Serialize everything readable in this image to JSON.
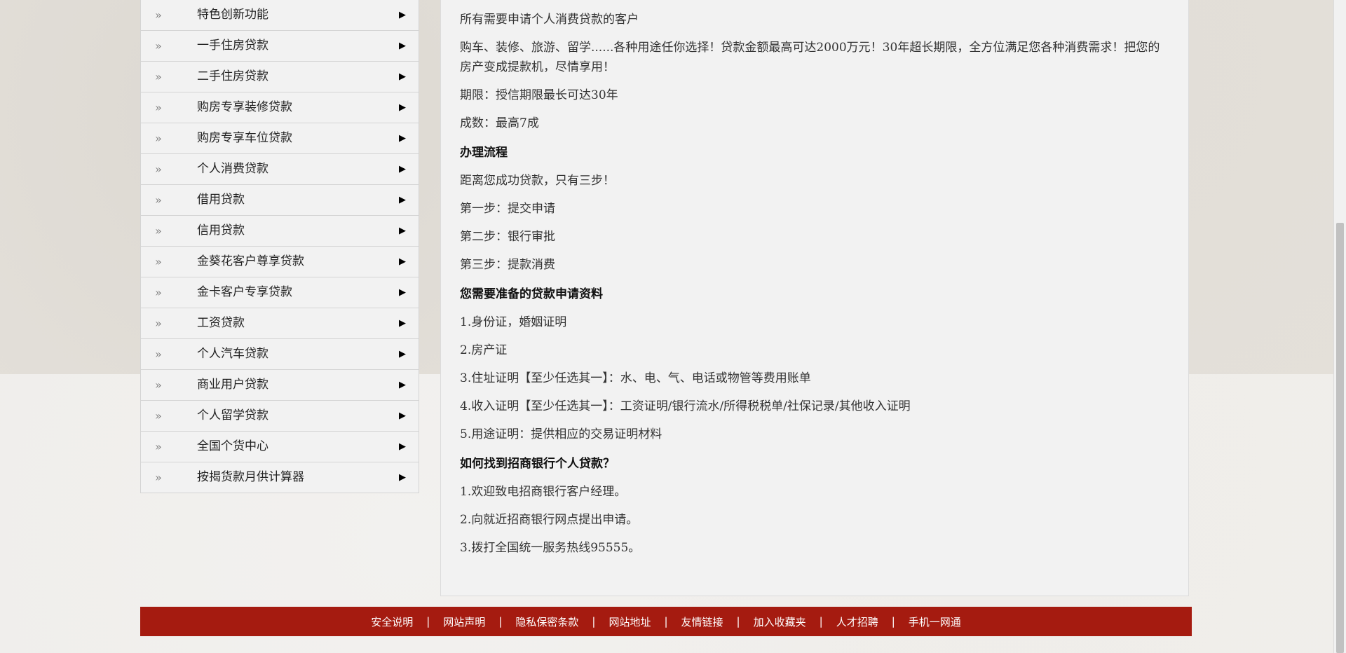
{
  "sidebar": {
    "bullet": "»",
    "arrow": "▶",
    "items": [
      {
        "label": "特色创新功能"
      },
      {
        "label": "一手住房贷款"
      },
      {
        "label": "二手住房贷款"
      },
      {
        "label": "购房专享装修贷款"
      },
      {
        "label": "购房专享车位贷款"
      },
      {
        "label": "个人消费贷款"
      },
      {
        "label": "借用贷款"
      },
      {
        "label": "信用贷款"
      },
      {
        "label": "金葵花客户尊享贷款"
      },
      {
        "label": "金卡客户专享贷款"
      },
      {
        "label": "工资贷款"
      },
      {
        "label": "个人汽车贷款"
      },
      {
        "label": "商业用户贷款"
      },
      {
        "label": "个人留学贷款"
      },
      {
        "label": "全国个货中心"
      },
      {
        "label": "按揭货款月供计算器"
      }
    ]
  },
  "content": {
    "intro": "所有需要申请个人消费贷款的客户",
    "description": "购车、装修、旅游、留学......各种用途任你选择！贷款金额最高可达2000万元！30年超长期限，全方位满足您各种消费需求！把您的房产变成提款机，尽情享用！",
    "term": "期限：授信期限最长可达30年",
    "ratio": "成数：最高7成",
    "process_heading": "办理流程",
    "process_lines": [
      "距离您成功贷款，只有三步！",
      "第一步：提交申请",
      "第二步：银行审批",
      "第三步：提款消费"
    ],
    "materials_heading": "您需要准备的贷款申请资料",
    "materials_lines": [
      "1.身份证，婚姻证明",
      "2.房产证",
      "3.住址证明【至少任选其一】：水、电、气、电话或物管等费用账单",
      "4.收入证明【至少任选其一】：工资证明/银行流水/所得税税单/社保记录/其他收入证明",
      "5.用途证明：提供相应的交易证明材料"
    ],
    "find_heading": "如何找到招商银行个人贷款？",
    "find_lines": [
      "1.欢迎致电招商银行客户经理。",
      "2.向就近招商银行网点提出申请。",
      "3.拨打全国统一服务热线95555。"
    ]
  },
  "footer": {
    "separator": "|",
    "links": [
      "安全说明",
      "网站声明",
      "隐私保密条款",
      "网站地址",
      "友情链接",
      "加入收藏夹",
      "人才招聘",
      "手机一网通"
    ]
  },
  "colors": {
    "footer_bg": "#a51b10",
    "panel_bg": "#f2f2f2"
  }
}
